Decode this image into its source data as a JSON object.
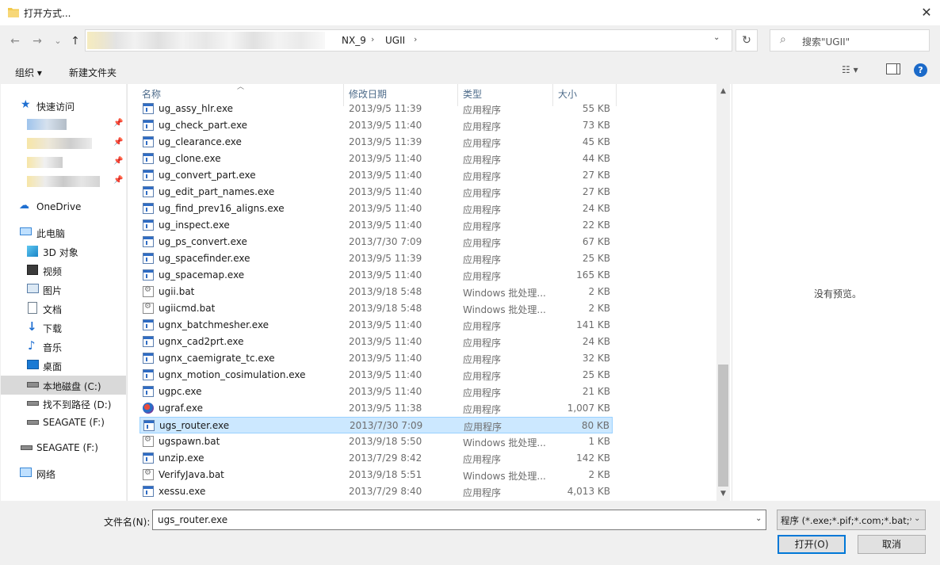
{
  "window": {
    "title": "打开方式...",
    "close_glyph": "✕"
  },
  "nav": {
    "back_glyph": "←",
    "forward_glyph": "→",
    "recent_glyph": "⌄",
    "up_glyph": "↑",
    "breadcrumbs": [
      "NX_9",
      "UGII"
    ],
    "refresh_glyph": "↻",
    "search_placeholder": "搜索\"UGII\""
  },
  "toolbar": {
    "organize_label": "组织 ▾",
    "new_folder_label": "新建文件夹"
  },
  "sidebar": {
    "quick_access": "快速访问",
    "onedrive": "OneDrive",
    "this_pc": "此电脑",
    "items": [
      "3D 对象",
      "视频",
      "图片",
      "文档",
      "下载",
      "音乐",
      "桌面",
      "本地磁盘 (C:)",
      "找不到路径 (D:)",
      "SEAGATE (F:)"
    ],
    "seagate2": "SEAGATE (F:)",
    "network": "网络"
  },
  "columns": {
    "name": "名称",
    "date": "修改日期",
    "type": "类型",
    "size": "大小"
  },
  "files": [
    {
      "name": "ug_assy_hlr.exe",
      "date": "2013/9/5 11:39",
      "type": "应用程序",
      "size": "55 KB",
      "icon": "exe"
    },
    {
      "name": "ug_check_part.exe",
      "date": "2013/9/5 11:40",
      "type": "应用程序",
      "size": "73 KB",
      "icon": "exe"
    },
    {
      "name": "ug_clearance.exe",
      "date": "2013/9/5 11:39",
      "type": "应用程序",
      "size": "45 KB",
      "icon": "exe"
    },
    {
      "name": "ug_clone.exe",
      "date": "2013/9/5 11:40",
      "type": "应用程序",
      "size": "44 KB",
      "icon": "exe"
    },
    {
      "name": "ug_convert_part.exe",
      "date": "2013/9/5 11:40",
      "type": "应用程序",
      "size": "27 KB",
      "icon": "exe"
    },
    {
      "name": "ug_edit_part_names.exe",
      "date": "2013/9/5 11:40",
      "type": "应用程序",
      "size": "27 KB",
      "icon": "exe"
    },
    {
      "name": "ug_find_prev16_aligns.exe",
      "date": "2013/9/5 11:40",
      "type": "应用程序",
      "size": "24 KB",
      "icon": "exe"
    },
    {
      "name": "ug_inspect.exe",
      "date": "2013/9/5 11:40",
      "type": "应用程序",
      "size": "22 KB",
      "icon": "exe"
    },
    {
      "name": "ug_ps_convert.exe",
      "date": "2013/7/30 7:09",
      "type": "应用程序",
      "size": "67 KB",
      "icon": "exe"
    },
    {
      "name": "ug_spacefinder.exe",
      "date": "2013/9/5 11:39",
      "type": "应用程序",
      "size": "25 KB",
      "icon": "exe"
    },
    {
      "name": "ug_spacemap.exe",
      "date": "2013/9/5 11:40",
      "type": "应用程序",
      "size": "165 KB",
      "icon": "exe"
    },
    {
      "name": "ugii.bat",
      "date": "2013/9/18 5:48",
      "type": "Windows 批处理...",
      "size": "2 KB",
      "icon": "bat"
    },
    {
      "name": "ugiicmd.bat",
      "date": "2013/9/18 5:48",
      "type": "Windows 批处理...",
      "size": "2 KB",
      "icon": "bat"
    },
    {
      "name": "ugnx_batchmesher.exe",
      "date": "2013/9/5 11:40",
      "type": "应用程序",
      "size": "141 KB",
      "icon": "exe"
    },
    {
      "name": "ugnx_cad2prt.exe",
      "date": "2013/9/5 11:40",
      "type": "应用程序",
      "size": "24 KB",
      "icon": "exe"
    },
    {
      "name": "ugnx_caemigrate_tc.exe",
      "date": "2013/9/5 11:40",
      "type": "应用程序",
      "size": "32 KB",
      "icon": "exe"
    },
    {
      "name": "ugnx_motion_cosimulation.exe",
      "date": "2013/9/5 11:40",
      "type": "应用程序",
      "size": "25 KB",
      "icon": "exe"
    },
    {
      "name": "ugpc.exe",
      "date": "2013/9/5 11:40",
      "type": "应用程序",
      "size": "21 KB",
      "icon": "exe"
    },
    {
      "name": "ugraf.exe",
      "date": "2013/9/5 11:38",
      "type": "应用程序",
      "size": "1,007 KB",
      "icon": "app"
    },
    {
      "name": "ugs_router.exe",
      "date": "2013/7/30 7:09",
      "type": "应用程序",
      "size": "80 KB",
      "icon": "exe",
      "selected": true
    },
    {
      "name": "ugspawn.bat",
      "date": "2013/9/18 5:50",
      "type": "Windows 批处理...",
      "size": "1 KB",
      "icon": "bat"
    },
    {
      "name": "unzip.exe",
      "date": "2013/7/29 8:42",
      "type": "应用程序",
      "size": "142 KB",
      "icon": "exe"
    },
    {
      "name": "VerifyJava.bat",
      "date": "2013/9/18 5:51",
      "type": "Windows 批处理...",
      "size": "2 KB",
      "icon": "bat"
    },
    {
      "name": "xessu.exe",
      "date": "2013/7/29 8:40",
      "type": "应用程序",
      "size": "4,013 KB",
      "icon": "exe"
    }
  ],
  "preview": {
    "text": "没有预览。"
  },
  "bottom": {
    "filename_label": "文件名(N):",
    "filename_value": "ugs_router.exe",
    "filter_text": "程序 (*.exe;*.pif;*.com;*.bat;*.",
    "open_label": "打开(O)",
    "cancel_label": "取消"
  },
  "colors": {
    "selection_bg": "#cce8ff",
    "selection_border": "#99d1ff",
    "accent": "#0078d7"
  }
}
